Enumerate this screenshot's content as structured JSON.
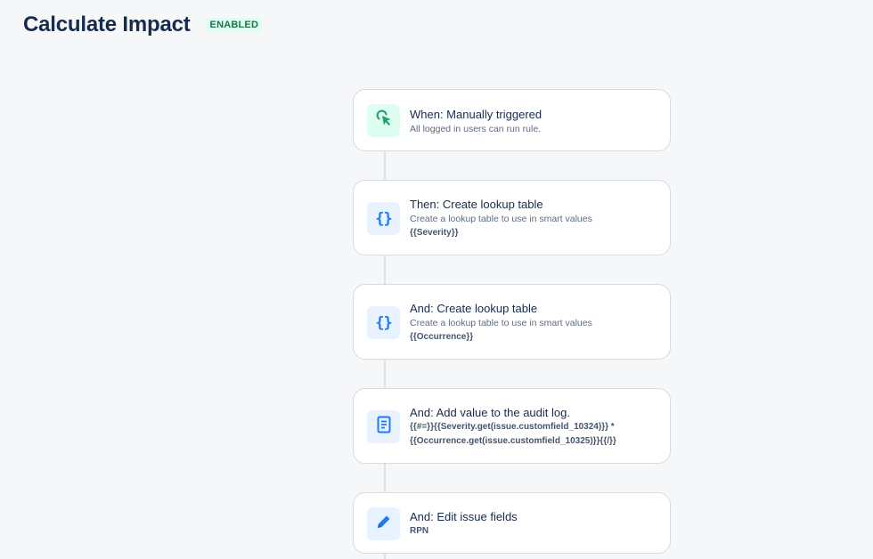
{
  "header": {
    "title": "Calculate Impact",
    "status": "ENABLED"
  },
  "steps": [
    {
      "title": "When: Manually triggered",
      "description": "All logged in users can run rule.",
      "icon": "cursor-click-icon"
    },
    {
      "title": "Then: Create lookup table",
      "description": "Create a lookup table to use in smart values",
      "code": "{{Severity}}",
      "icon": "braces-icon"
    },
    {
      "title": "And: Create lookup table",
      "description": "Create a lookup table to use in smart values",
      "code": "{{Occurrence}}",
      "icon": "braces-icon"
    },
    {
      "title": "And: Add value to the audit log.",
      "code_line1": "{{#=}}{{Severity.get(issue.customfield_10324)}} *",
      "code_line2": "{{Occurrence.get(issue.customfield_10325)}}{{/}}",
      "icon": "document-icon"
    },
    {
      "title": "And: Edit issue fields",
      "code": "RPN",
      "icon": "pencil-icon"
    }
  ],
  "colors": {
    "accent_blue": "#1d7afc",
    "trigger_green": "#22a06b",
    "badge_bg": "#dcfff1",
    "badge_text": "#216e4e"
  }
}
